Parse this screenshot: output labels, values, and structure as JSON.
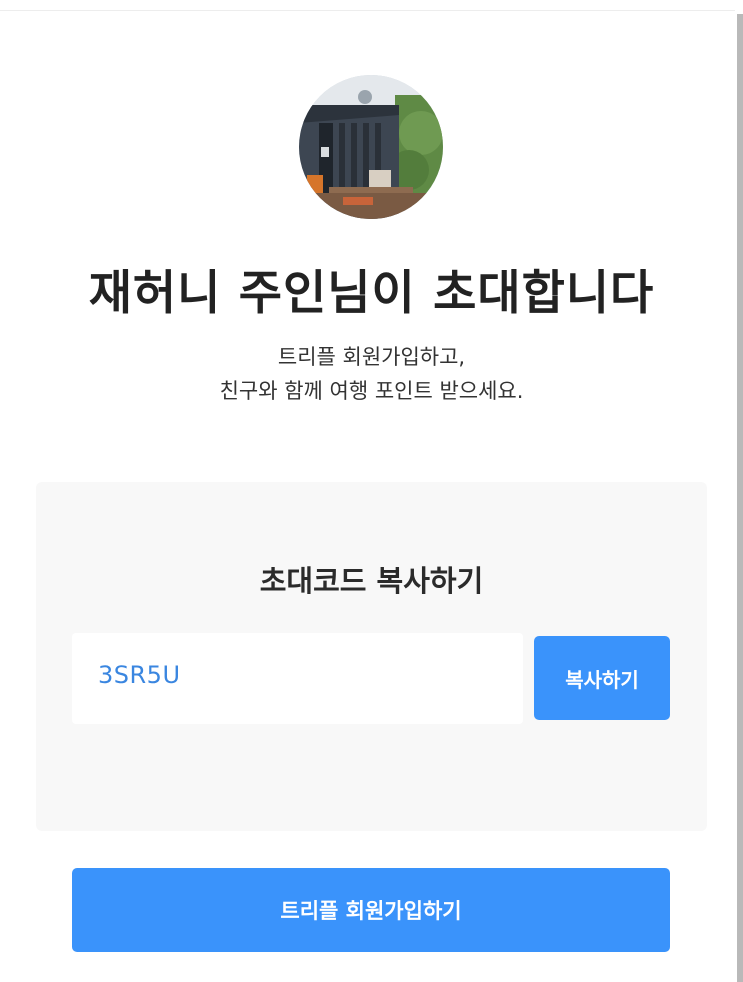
{
  "header": {
    "title": "재허니 주인님이 초대합니다",
    "subtitle_lines": [
      "트리플 회원가입하고,",
      "친구와 함께 여행 포인트 받으세요."
    ]
  },
  "avatar": {
    "icon": "profile-photo-house"
  },
  "invite_code_card": {
    "title": "초대코드 복사하기",
    "code": "3SR5U",
    "copy_label": "복사하기"
  },
  "signup": {
    "label": "트리플 회원가입하기"
  },
  "colors": {
    "accent": "#3a93fb",
    "code_text": "#3a86e0",
    "card_bg": "#f8f8f8",
    "title_text": "#222222"
  }
}
